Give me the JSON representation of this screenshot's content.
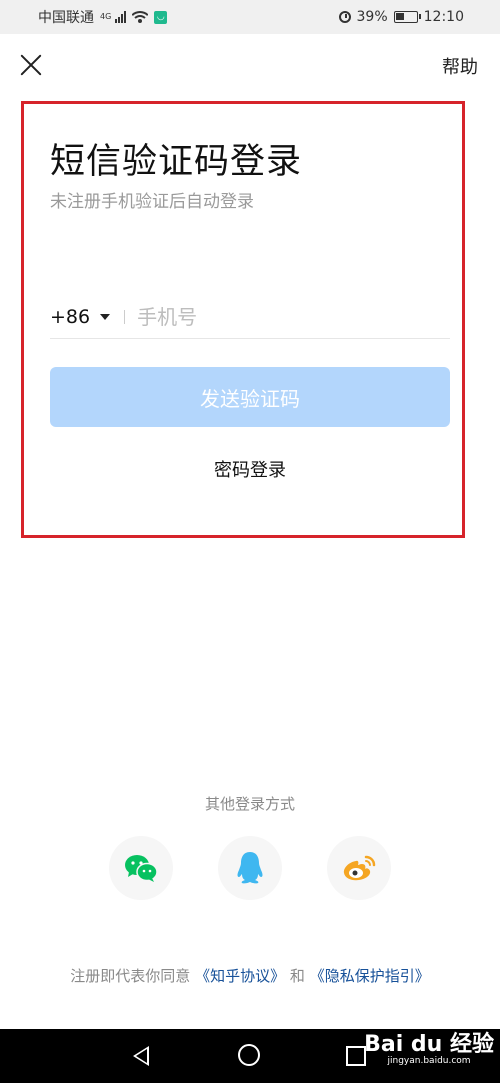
{
  "status_bar": {
    "carrier": "中国联通",
    "network": "4G",
    "battery": "39%",
    "time": "12:10"
  },
  "header": {
    "help_label": "帮助"
  },
  "login": {
    "title": "短信验证码登录",
    "subtitle": "未注册手机验证后自动登录",
    "country_code": "+86",
    "phone_placeholder": "手机号",
    "phone_value": "",
    "send_code_label": "发送验证码",
    "password_login_label": "密码登录"
  },
  "other_login": {
    "label": "其他登录方式",
    "options": [
      {
        "name": "wechat",
        "icon": "wechat-icon",
        "color": "#07c160"
      },
      {
        "name": "qq",
        "icon": "qq-icon",
        "color": "#3fb7f0"
      },
      {
        "name": "weibo",
        "icon": "weibo-icon",
        "color": "#f5a623"
      }
    ]
  },
  "agreement": {
    "prefix": "注册即代表你同意",
    "terms_link": "《知乎协议》",
    "and": "和",
    "privacy_link": "《隐私保护指引》"
  },
  "watermark": {
    "main": "Bai du 经验",
    "sub": "jingyan.baidu.com"
  },
  "colors": {
    "highlight_border": "#d6232a",
    "button_disabled": "#b3d6fc",
    "link": "#175199"
  }
}
